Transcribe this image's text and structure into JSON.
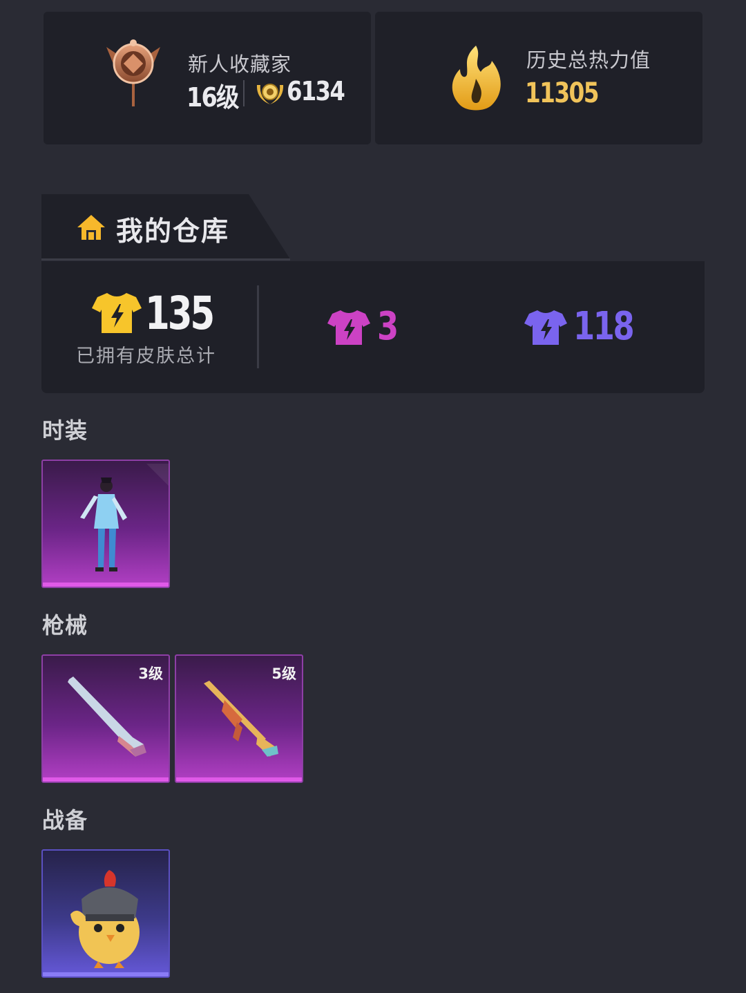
{
  "profile": {
    "collector_title": "新人收藏家",
    "level_text": "16级",
    "points": "6134",
    "heat_title": "历史总热力值",
    "heat_value": "11305"
  },
  "warehouse": {
    "title": "我的仓库",
    "total_count": "135",
    "total_label": "已拥有皮肤总计",
    "epic_count": "3",
    "rare_count": "118",
    "colors": {
      "gold": "#f7c52b",
      "epic": "#cc42c4",
      "rare": "#7a64ee"
    }
  },
  "categories": [
    {
      "label": "时装",
      "items": [
        {
          "rarity": "epic",
          "icon": "character-outfit-icon",
          "level": ""
        }
      ]
    },
    {
      "label": "枪械",
      "items": [
        {
          "rarity": "epic",
          "icon": "rifle-icon",
          "level": "3级"
        },
        {
          "rarity": "epic",
          "icon": "assault-rifle-icon",
          "level": "5级"
        }
      ]
    },
    {
      "label": "战备",
      "items": [
        {
          "rarity": "rare",
          "icon": "chicken-helmet-icon",
          "level": ""
        }
      ]
    }
  ]
}
